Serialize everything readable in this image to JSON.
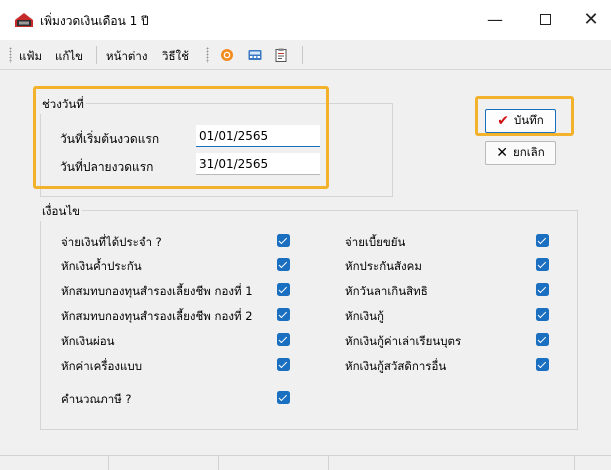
{
  "window": {
    "title": "เพิ่มงวดเงินเดือน 1 ปี",
    "minimize_glyph": "—",
    "close_glyph": "✕"
  },
  "menubar": {
    "items": [
      "แฟ้ม",
      "แก้ไข",
      "หน้าต่าง",
      "วิธีใช้"
    ],
    "toolbar_icons": [
      "help-circle-icon",
      "calculator-icon",
      "clipboard-icon"
    ]
  },
  "date_group": {
    "label": "ช่วงวันที่",
    "start_label": "วันที่เริ่มต้นงวดแรก",
    "start_value": "01/01/2565",
    "end_label": "วันที่ปลายงวดแรก",
    "end_value": "31/01/2565"
  },
  "actions": {
    "save_glyph": "✔",
    "save_label": "บันทึก",
    "cancel_glyph": "✕",
    "cancel_label": "ยกเลิก"
  },
  "conditions": {
    "label": "เงื่อนไข",
    "left": [
      {
        "label": "จ่ายเงินที่ได้ประจำ ?",
        "checked": true
      },
      {
        "label": "หักเงินค้ำประกัน",
        "checked": true
      },
      {
        "label": "หักสมทบกองทุนสำรองเลี้ยงชีพ กองที่ 1",
        "checked": true
      },
      {
        "label": "หักสมทบกองทุนสำรองเลี้ยงชีพ กองที่ 2",
        "checked": true
      },
      {
        "label": "หักเงินผ่อน",
        "checked": true
      },
      {
        "label": "หักค่าเครื่องแบบ",
        "checked": true
      },
      {
        "label": "คำนวณภาษี ?",
        "checked": true
      }
    ],
    "right": [
      {
        "label": "จ่ายเบี้ยขยัน",
        "checked": true
      },
      {
        "label": "หักประกันสังคม",
        "checked": true
      },
      {
        "label": "หักวันลาเกินสิทธิ",
        "checked": true
      },
      {
        "label": "หักเงินกู้",
        "checked": true
      },
      {
        "label": "หักเงินกู้ค่าเล่าเรียนบุตร",
        "checked": true
      },
      {
        "label": "หักเงินกู้สวัสดิการอื่น",
        "checked": true
      }
    ]
  },
  "colors": {
    "accent": "#1a6fc0",
    "highlight": "#f2b22b",
    "save_check": "#d20f0f"
  }
}
